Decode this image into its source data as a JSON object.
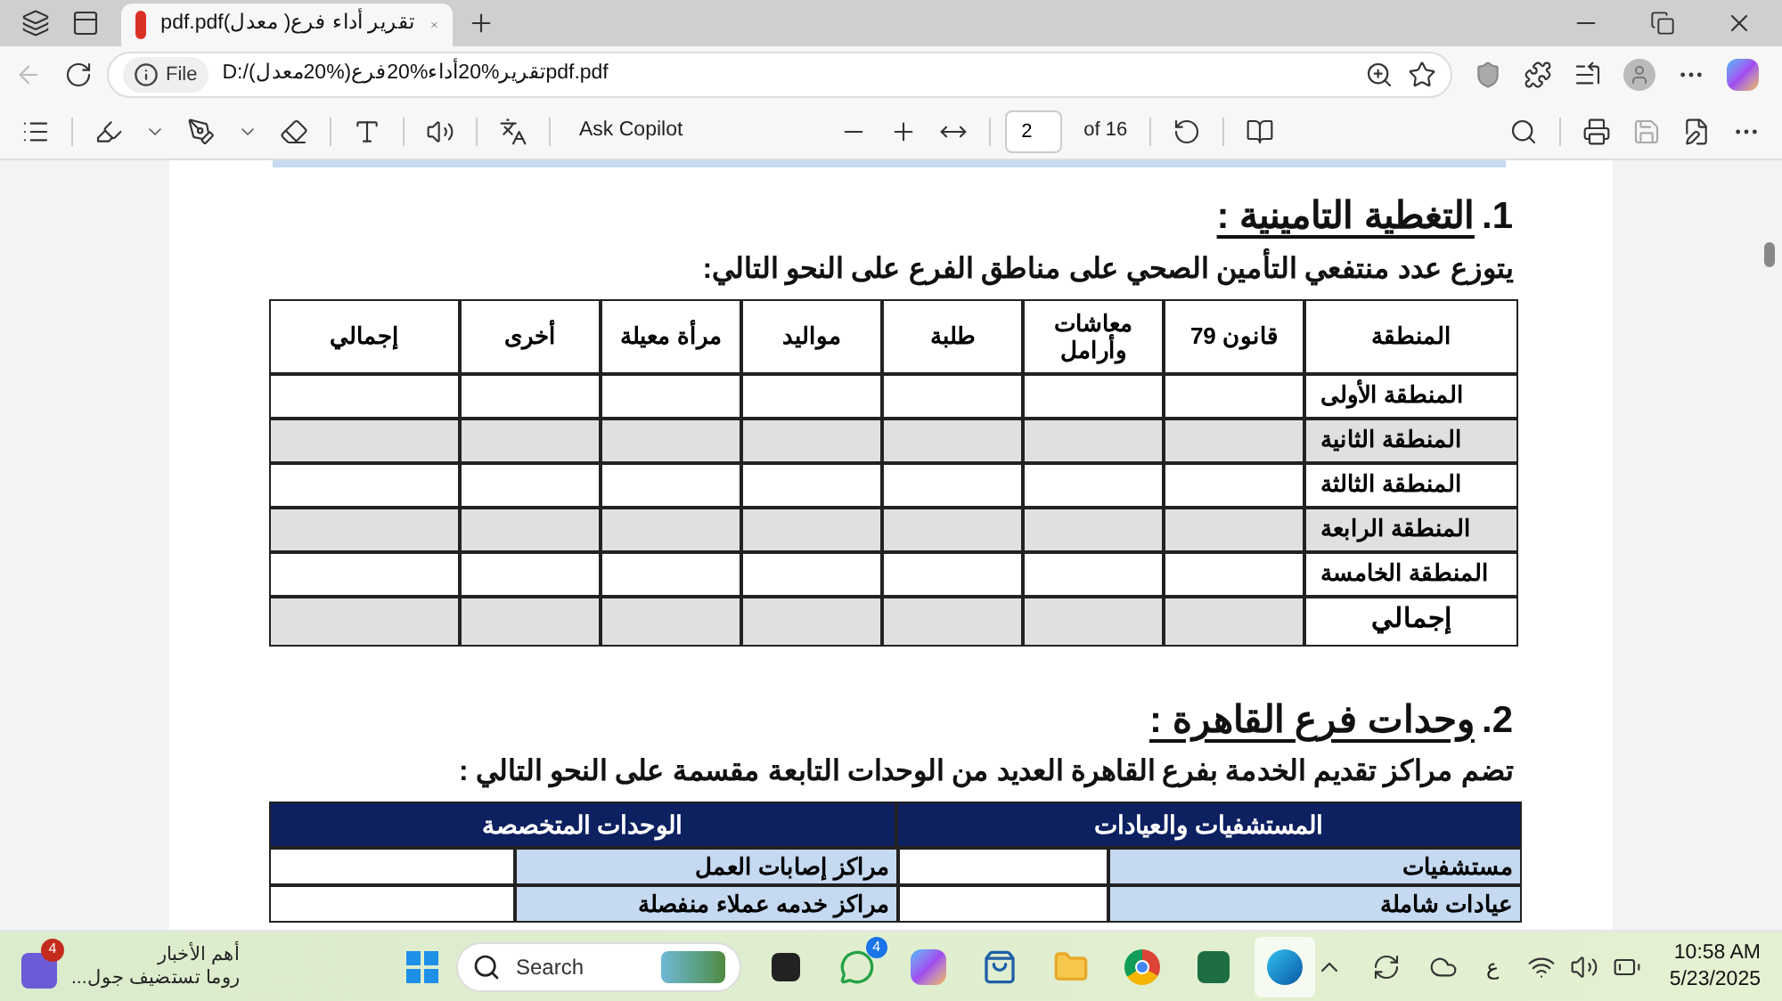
{
  "browser": {
    "tab_title": "تقرير أداء فرع( معدل)pdf.pdf",
    "address": {
      "scheme": "File",
      "url": "D:/تقرير%20أداء%20فرع(%20معدل)pdf.pdf"
    }
  },
  "pdf_toolbar": {
    "ask_copilot": "Ask Copilot",
    "page_number": "2",
    "page_count": "of 16"
  },
  "section_1": {
    "number": "1.",
    "heading": "التغطية التامينية :",
    "intro": "يتوزع عدد منتفعي التأمين الصحي على مناطق الفرع على النحو التالي:",
    "table": {
      "columns": [
        "المنطقة",
        "قانون 79",
        "معاشات وأرامل",
        "طلبة",
        "مواليد",
        "مرأة معيلة",
        "أخرى",
        "إجمالي"
      ],
      "rows": [
        {
          "kind": "region",
          "name": "المنطقة الأولى",
          "shaded": false
        },
        {
          "kind": "region",
          "name": "المنطقة الثانية",
          "shaded": true
        },
        {
          "kind": "region",
          "name": "المنطقة الثالثة",
          "shaded": false
        },
        {
          "kind": "region",
          "name": "المنطقة الرابعة",
          "shaded": true
        },
        {
          "kind": "region",
          "name": "المنطقة الخامسة",
          "shaded": false
        },
        {
          "kind": "total",
          "name": "إجمالي",
          "shaded": true
        }
      ]
    }
  },
  "section_2": {
    "number": "2.",
    "heading": "وحدات فرع القاهرة :",
    "intro": "تضم مراكز تقديم الخدمة بفرع القاهرة العديد من الوحدات التابعة مقسمة على النحو التالي :",
    "table": {
      "columns": [
        "المستشفيات والعيادات",
        "الوحدات المتخصصة"
      ],
      "rows": [
        [
          "مستشفيات",
          "مراكز إصابات العمل"
        ],
        [
          "عيادات شاملة",
          "مراكز خدمه عملاء منفصلة"
        ]
      ]
    }
  },
  "taskbar": {
    "news_badge": "4",
    "news_title": "أهم الأخبار",
    "news_subtitle": "روما تستضيف جول...",
    "search_placeholder": "Search",
    "chat_badge": "4",
    "language": "ع",
    "time": "10:58 AM",
    "date": "5/23/2025"
  }
}
